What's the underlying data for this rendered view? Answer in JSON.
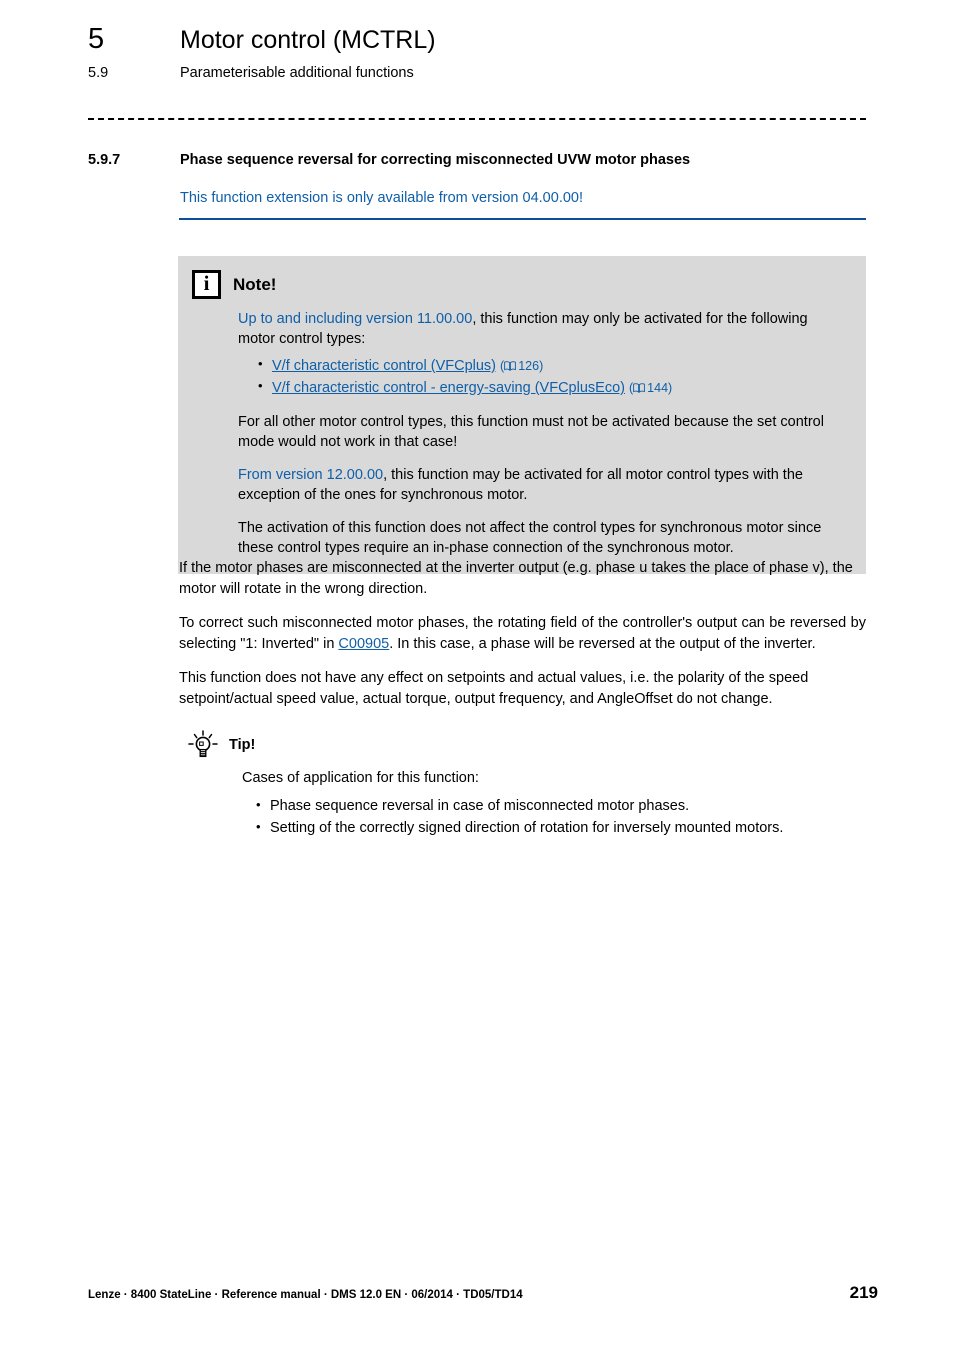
{
  "header": {
    "chapter_number": "5",
    "chapter_title": "Motor control (MCTRL)",
    "section_number": "5.9",
    "section_title": "Parameterisable additional functions"
  },
  "section": {
    "number": "5.9.7",
    "title": "Phase sequence reversal for correcting misconnected UVW motor phases",
    "availability_note": "This function extension is only available from version 04.00.00!"
  },
  "note": {
    "icon": "info-icon",
    "title": "Note!",
    "para1_link": "Up to and including version 11.00.00",
    "para1_rest": ", this function may only be activated for the following motor control types:",
    "items": [
      {
        "link": "V/f characteristic control (VFCplus)",
        "page": "126",
        "icon": "book-icon"
      },
      {
        "link": "V/f characteristic control - energy-saving (VFCplusEco)",
        "page": "144",
        "icon": "book-icon"
      }
    ],
    "para2": "For all other motor control types, this function must not be activated because the set control mode would not work in that case!",
    "para3_link": "From version 12.00.00",
    "para3_rest": ", this function may be activated for all motor control types with the exception of the ones for synchronous motor.",
    "para4": "The activation of this function does not affect the control types for synchronous motor since these control types require an in-phase connection of the synchronous motor."
  },
  "body": {
    "para1": "If the motor phases are misconnected at the inverter output (e.g. phase u takes the place of phase v), the motor will rotate in the wrong direction.",
    "para2_pre": "To correct such misconnected motor phases, the rotating field of the controller's output can be reversed by selecting \"1: Inverted\" in ",
    "para2_link": "C00905",
    "para2_post": ". In this case, a phase will be reversed at the output of the inverter.",
    "para3": "This function does not have any effect on setpoints and actual values, i.e. the polarity of the speed setpoint/actual speed value, actual torque, output frequency, and AngleOffset do not change."
  },
  "tip": {
    "icon": "lightbulb-icon",
    "title": "Tip!",
    "intro": "Cases of application for this function:",
    "items": [
      "Phase sequence reversal in case of misconnected motor phases.",
      "Setting of the correctly signed direction of rotation for inversely mounted motors."
    ]
  },
  "footer": {
    "text": "Lenze · 8400 StateLine · Reference manual · DMS 12.0 EN · 06/2014 · TD05/TD14",
    "page_number": "219"
  },
  "colors": {
    "link_blue": "#0f5fa8",
    "rule_blue": "#0b4f96",
    "note_background": "#d9d9d9"
  }
}
